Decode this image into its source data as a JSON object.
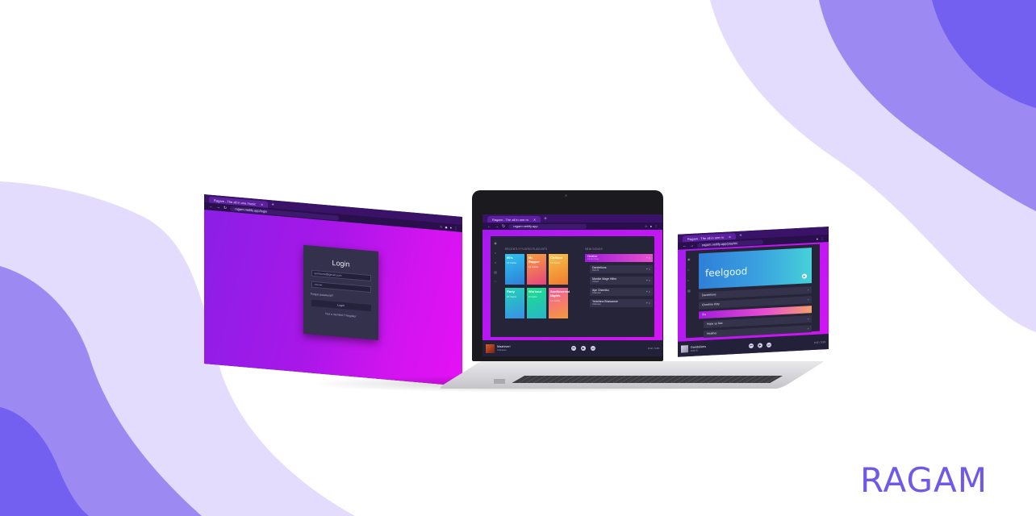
{
  "brand": "RAGAM",
  "colors": {
    "wave_light": "#e4dcfd",
    "wave_mid": "#9c8af2",
    "wave_dark": "#735ff0",
    "gradient_start": "#8a1fe6",
    "gradient_end": "#e511f5",
    "panel": "#262438",
    "brand_text": "#7058e8"
  },
  "login_window": {
    "tab_title": "Ragam - The all in one music",
    "url": "ragam.netlify.app/login",
    "card": {
      "title": "Login",
      "email_value": "someone@gmail.com",
      "password_value": "••••••••",
      "forgot_label": "Forgot password?",
      "submit_label": "Login",
      "register_label": "Not a member? Register"
    }
  },
  "app_window": {
    "tab_title": "Ragam - The all in one m",
    "url": "ragam.netlify.app",
    "recent_label": "RECENTLY PLAYED PLAYLISTS",
    "new_label": "NEW SONGS",
    "playlists": [
      {
        "name": "90's",
        "sub": "15 tracks",
        "color_a": "#2dc5f0",
        "color_b": "#2f7fd8"
      },
      {
        "name": "Mr. Rapper",
        "sub": "12 tracks",
        "color_a": "#f7a13a",
        "color_b": "#e8437e"
      },
      {
        "name": "Chillout",
        "sub": "18 tracks",
        "color_a": "#f6c24a",
        "color_b": "#f07a2f"
      },
      {
        "name": "Party",
        "sub": "20 tracks",
        "color_a": "#1fd6b4",
        "color_b": "#3b8ee8"
      },
      {
        "name": "Workout",
        "sub": "9 tracks",
        "color_a": "#1ce08a",
        "color_b": "#27b6c9"
      },
      {
        "name": "Sunflowered Nights",
        "sub": "14 tracks",
        "color_a": "#f35aa0",
        "color_b": "#f59a3b"
      }
    ],
    "songs": [
      {
        "title": "Heather",
        "artist": "Conan Gray"
      },
      {
        "title": "Dandelions",
        "artist": "Ruth B."
      },
      {
        "title": "Manike Mage Hithe",
        "artist": "Yohani"
      },
      {
        "title": "Aye Chemiko",
        "artist": "Unknown"
      },
      {
        "title": "Yedchina Bhawanne",
        "artist": "Unknown"
      }
    ],
    "player": {
      "title": "Maahiveri",
      "artist": "Unknown",
      "time": "0:12 / 3:45"
    }
  },
  "playlist_window": {
    "tab_title": "Ragam - The all in one m",
    "url": "ragam.netlify.app/playlist",
    "playlist_title": "feelgood",
    "songs": [
      {
        "title": "Dandelions",
        "active": false,
        "indent": false
      },
      {
        "title": "Cheshire Kitty",
        "active": false,
        "indent": false
      },
      {
        "title": "Sia",
        "active": true,
        "indent": false
      },
      {
        "title": "Hope so Not",
        "active": false,
        "indent": true
      },
      {
        "title": "Heather",
        "active": false,
        "indent": true
      }
    ],
    "player": {
      "title": "Dandelions",
      "artist": "Ruth B.",
      "time": "0:42 / 3:53"
    }
  }
}
